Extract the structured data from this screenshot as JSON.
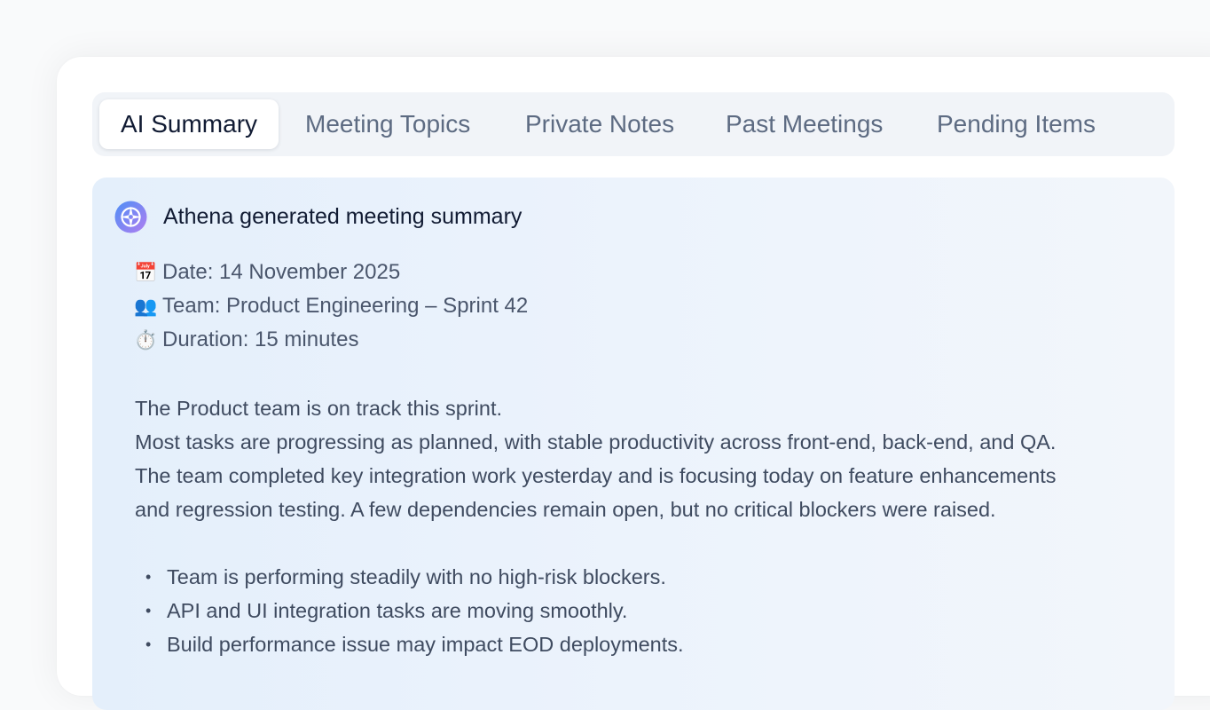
{
  "tabs": [
    {
      "label": "AI Summary",
      "active": true
    },
    {
      "label": "Meeting Topics",
      "active": false
    },
    {
      "label": "Private Notes",
      "active": false
    },
    {
      "label": "Past Meetings",
      "active": false
    },
    {
      "label": "Pending Items",
      "active": false
    }
  ],
  "summary": {
    "icon": "compass-icon",
    "title": "Athena generated meeting summary",
    "meta": [
      {
        "icon": "calendar-icon",
        "emoji": "📅",
        "text": "Date: 14 November 2025"
      },
      {
        "icon": "team-icon",
        "emoji": "👥",
        "text": "Team: Product Engineering – Sprint 42"
      },
      {
        "icon": "stopwatch-icon",
        "emoji": "⏱️",
        "text": "Duration: 15 minutes"
      }
    ],
    "paragraph_lines": [
      "The Product team is on track this sprint.",
      "Most tasks are progressing as planned, with stable productivity across front-end, back-end, and QA.",
      "The team completed key integration work yesterday and is focusing today on feature enhancements",
      "and regression testing. A few dependencies remain open, but no critical blockers were raised."
    ],
    "bullets": [
      "Team is performing steadily with no high-risk blockers.",
      "API and UI integration tasks are moving smoothly.",
      "Build performance issue may impact EOD deployments."
    ]
  },
  "colors": {
    "accent_gradient_start": "#5b8df5",
    "accent_gradient_end": "#a97ef0",
    "panel_background": "#e8f1fb"
  }
}
